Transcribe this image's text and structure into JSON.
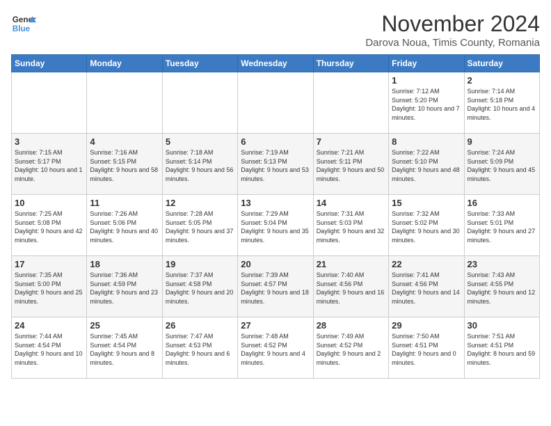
{
  "header": {
    "logo_line1": "General",
    "logo_line2": "Blue",
    "month": "November 2024",
    "location": "Darova Noua, Timis County, Romania"
  },
  "days_of_week": [
    "Sunday",
    "Monday",
    "Tuesday",
    "Wednesday",
    "Thursday",
    "Friday",
    "Saturday"
  ],
  "weeks": [
    [
      {
        "num": "",
        "info": ""
      },
      {
        "num": "",
        "info": ""
      },
      {
        "num": "",
        "info": ""
      },
      {
        "num": "",
        "info": ""
      },
      {
        "num": "",
        "info": ""
      },
      {
        "num": "1",
        "info": "Sunrise: 7:12 AM\nSunset: 5:20 PM\nDaylight: 10 hours\nand 7 minutes."
      },
      {
        "num": "2",
        "info": "Sunrise: 7:14 AM\nSunset: 5:18 PM\nDaylight: 10 hours\nand 4 minutes."
      }
    ],
    [
      {
        "num": "3",
        "info": "Sunrise: 7:15 AM\nSunset: 5:17 PM\nDaylight: 10 hours\nand 1 minute."
      },
      {
        "num": "4",
        "info": "Sunrise: 7:16 AM\nSunset: 5:15 PM\nDaylight: 9 hours\nand 58 minutes."
      },
      {
        "num": "5",
        "info": "Sunrise: 7:18 AM\nSunset: 5:14 PM\nDaylight: 9 hours\nand 56 minutes."
      },
      {
        "num": "6",
        "info": "Sunrise: 7:19 AM\nSunset: 5:13 PM\nDaylight: 9 hours\nand 53 minutes."
      },
      {
        "num": "7",
        "info": "Sunrise: 7:21 AM\nSunset: 5:11 PM\nDaylight: 9 hours\nand 50 minutes."
      },
      {
        "num": "8",
        "info": "Sunrise: 7:22 AM\nSunset: 5:10 PM\nDaylight: 9 hours\nand 48 minutes."
      },
      {
        "num": "9",
        "info": "Sunrise: 7:24 AM\nSunset: 5:09 PM\nDaylight: 9 hours\nand 45 minutes."
      }
    ],
    [
      {
        "num": "10",
        "info": "Sunrise: 7:25 AM\nSunset: 5:08 PM\nDaylight: 9 hours\nand 42 minutes."
      },
      {
        "num": "11",
        "info": "Sunrise: 7:26 AM\nSunset: 5:06 PM\nDaylight: 9 hours\nand 40 minutes."
      },
      {
        "num": "12",
        "info": "Sunrise: 7:28 AM\nSunset: 5:05 PM\nDaylight: 9 hours\nand 37 minutes."
      },
      {
        "num": "13",
        "info": "Sunrise: 7:29 AM\nSunset: 5:04 PM\nDaylight: 9 hours\nand 35 minutes."
      },
      {
        "num": "14",
        "info": "Sunrise: 7:31 AM\nSunset: 5:03 PM\nDaylight: 9 hours\nand 32 minutes."
      },
      {
        "num": "15",
        "info": "Sunrise: 7:32 AM\nSunset: 5:02 PM\nDaylight: 9 hours\nand 30 minutes."
      },
      {
        "num": "16",
        "info": "Sunrise: 7:33 AM\nSunset: 5:01 PM\nDaylight: 9 hours\nand 27 minutes."
      }
    ],
    [
      {
        "num": "17",
        "info": "Sunrise: 7:35 AM\nSunset: 5:00 PM\nDaylight: 9 hours\nand 25 minutes."
      },
      {
        "num": "18",
        "info": "Sunrise: 7:36 AM\nSunset: 4:59 PM\nDaylight: 9 hours\nand 23 minutes."
      },
      {
        "num": "19",
        "info": "Sunrise: 7:37 AM\nSunset: 4:58 PM\nDaylight: 9 hours\nand 20 minutes."
      },
      {
        "num": "20",
        "info": "Sunrise: 7:39 AM\nSunset: 4:57 PM\nDaylight: 9 hours\nand 18 minutes."
      },
      {
        "num": "21",
        "info": "Sunrise: 7:40 AM\nSunset: 4:56 PM\nDaylight: 9 hours\nand 16 minutes."
      },
      {
        "num": "22",
        "info": "Sunrise: 7:41 AM\nSunset: 4:56 PM\nDaylight: 9 hours\nand 14 minutes."
      },
      {
        "num": "23",
        "info": "Sunrise: 7:43 AM\nSunset: 4:55 PM\nDaylight: 9 hours\nand 12 minutes."
      }
    ],
    [
      {
        "num": "24",
        "info": "Sunrise: 7:44 AM\nSunset: 4:54 PM\nDaylight: 9 hours\nand 10 minutes."
      },
      {
        "num": "25",
        "info": "Sunrise: 7:45 AM\nSunset: 4:54 PM\nDaylight: 9 hours\nand 8 minutes."
      },
      {
        "num": "26",
        "info": "Sunrise: 7:47 AM\nSunset: 4:53 PM\nDaylight: 9 hours\nand 6 minutes."
      },
      {
        "num": "27",
        "info": "Sunrise: 7:48 AM\nSunset: 4:52 PM\nDaylight: 9 hours\nand 4 minutes."
      },
      {
        "num": "28",
        "info": "Sunrise: 7:49 AM\nSunset: 4:52 PM\nDaylight: 9 hours\nand 2 minutes."
      },
      {
        "num": "29",
        "info": "Sunrise: 7:50 AM\nSunset: 4:51 PM\nDaylight: 9 hours\nand 0 minutes."
      },
      {
        "num": "30",
        "info": "Sunrise: 7:51 AM\nSunset: 4:51 PM\nDaylight: 8 hours\nand 59 minutes."
      }
    ]
  ]
}
